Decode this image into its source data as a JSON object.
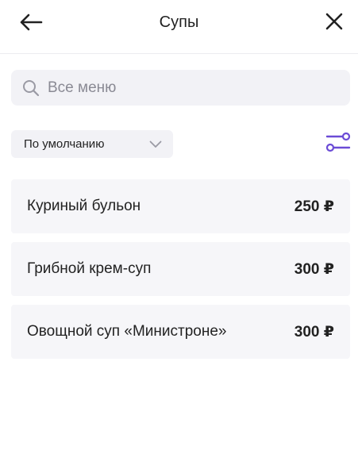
{
  "header": {
    "title": "Супы",
    "back_icon": "arrow-left-icon",
    "close_icon": "close-icon"
  },
  "search": {
    "placeholder": "Все меню",
    "value": "",
    "icon": "search-icon"
  },
  "sort": {
    "selected": "По умолчанию",
    "icon": "chevron-down-icon"
  },
  "filter": {
    "icon": "filter-sliders-icon",
    "color": "#6b4bd6"
  },
  "items": [
    {
      "name": "Куриный бульон",
      "price": "250 ₽"
    },
    {
      "name": "Грибной крем-суп",
      "price": "300 ₽"
    },
    {
      "name": "Овощной суп «Министроне»",
      "price": "300 ₽"
    }
  ]
}
